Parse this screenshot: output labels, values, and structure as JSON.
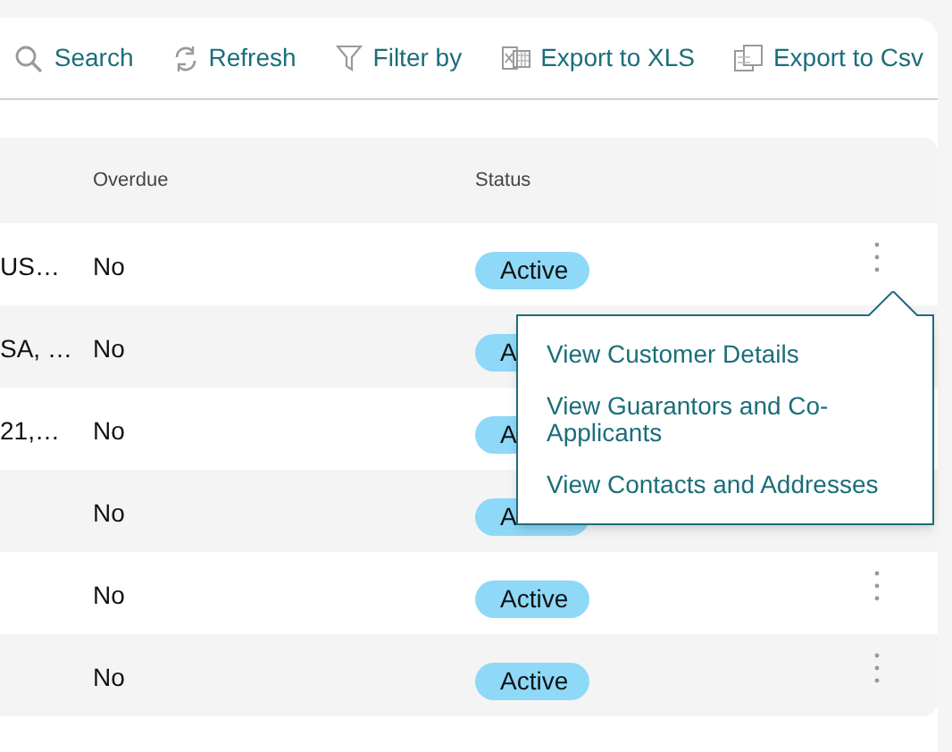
{
  "toolbar": [
    {
      "kind": "search",
      "label": "Search"
    },
    {
      "kind": "refresh",
      "label": "Refresh"
    },
    {
      "kind": "filter",
      "label": "Filter by"
    },
    {
      "kind": "xls",
      "label": "Export to XLS"
    },
    {
      "kind": "csv",
      "label": "Export to Csv"
    }
  ],
  "table": {
    "columns": [
      "Overdue",
      "Status"
    ],
    "rows": [
      {
        "column_1": "US…",
        "overdue": "No",
        "status": "Active",
        "actions": true
      },
      {
        "column_1": "SA, …",
        "overdue": "No",
        "status": "A",
        "actions": false
      },
      {
        "column_1": "21,…",
        "overdue": "No",
        "status": "A",
        "actions": false
      },
      {
        "column_1": "",
        "overdue": "No",
        "status": "A",
        "actions": false
      },
      {
        "column_1": "",
        "overdue": "No",
        "status": "Active",
        "actions": true
      },
      {
        "column_1": "",
        "overdue": "No",
        "status": "Active",
        "actions": true
      }
    ]
  },
  "row_menu": {
    "items": [
      "View Customer Details",
      "View Guarantors and Co-Applicants",
      "View Contacts and Addresses"
    ]
  }
}
